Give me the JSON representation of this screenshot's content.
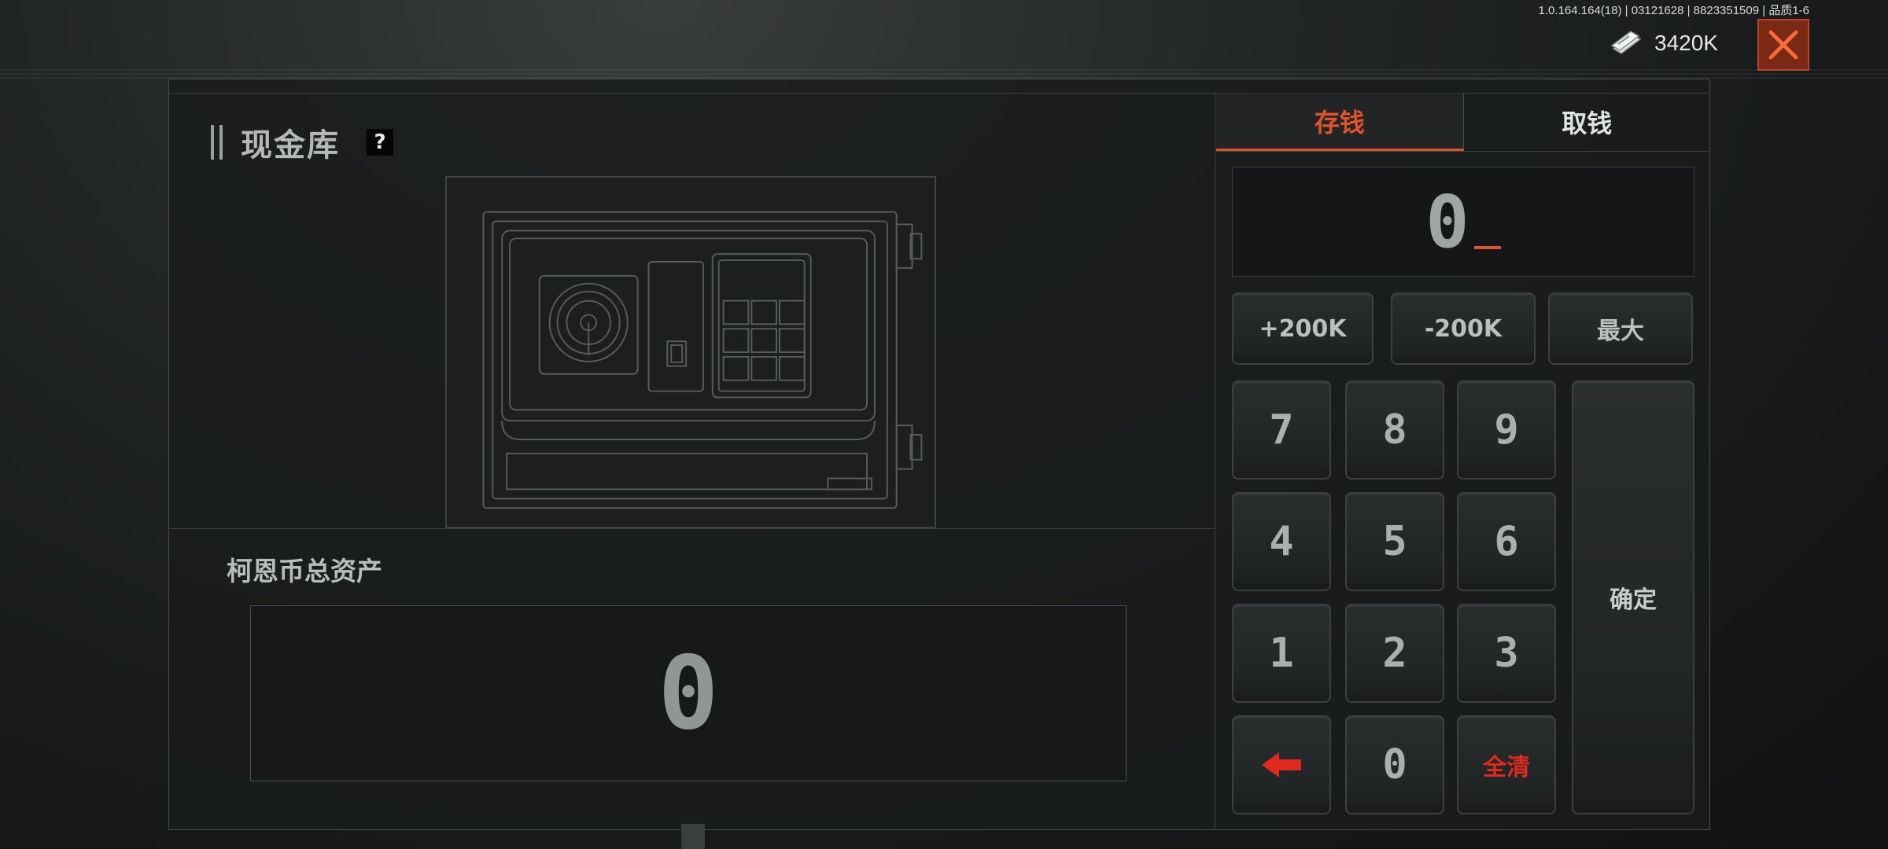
{
  "topbar": {
    "version_info": "1.0.164.164(18) | 03121628 | 8823351509 | 品质1-6",
    "currency_amount": "3420K",
    "icons": {
      "currency": "cash-stack-icon",
      "close": "close-x-icon"
    }
  },
  "vault": {
    "title": "现金库",
    "help_label": "?",
    "assets_label": "柯恩币总资产",
    "assets_value": "0"
  },
  "tabs": [
    {
      "label": "存钱",
      "active": true
    },
    {
      "label": "取钱",
      "active": false
    }
  ],
  "input": {
    "value": "0"
  },
  "quick_buttons": [
    {
      "label": "+200K"
    },
    {
      "label": "-200K"
    },
    {
      "label": "最大"
    }
  ],
  "keypad": {
    "digits": [
      "7",
      "8",
      "9",
      "4",
      "5",
      "6",
      "1",
      "2",
      "3"
    ],
    "zero": "0",
    "clear": "全清",
    "confirm": "确定",
    "backspace_icon": "left-arrow-icon"
  },
  "colors": {
    "accent": "#e0542c",
    "danger": "#e02a1e",
    "close_bg": "#7a2a14"
  }
}
